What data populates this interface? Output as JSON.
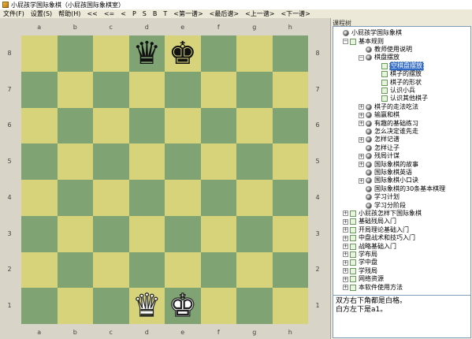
{
  "window": {
    "title": "小屁孩学国际象棋（小屁孩国际象棋室）"
  },
  "menu": [
    "文件(F)",
    "设置(S)",
    "帮助(H)",
    "<<",
    "<=",
    "<",
    "P",
    "S",
    "B",
    "T",
    "<第一谱>",
    "<最后谱>",
    "<上一谱>",
    "<下一谱>"
  ],
  "board": {
    "files": [
      "a",
      "b",
      "c",
      "d",
      "e",
      "f",
      "g",
      "h"
    ],
    "ranks": [
      "8",
      "7",
      "6",
      "5",
      "4",
      "3",
      "2",
      "1"
    ],
    "pieces": [
      {
        "square": "d8",
        "glyph": "♛",
        "color": "black",
        "name": "black-queen"
      },
      {
        "square": "e8",
        "glyph": "♚",
        "color": "black",
        "name": "black-king"
      },
      {
        "square": "d1",
        "glyph": "♛",
        "color": "white",
        "name": "white-queen"
      },
      {
        "square": "e1",
        "glyph": "♚",
        "color": "white",
        "name": "white-king"
      }
    ],
    "colors": {
      "light": "#d7d37a",
      "dark": "#7fa372"
    }
  },
  "tree": {
    "header": "课程树",
    "nodes": [
      {
        "label": "小屁孩学国际象棋",
        "level": 0,
        "icon": "ball",
        "expander": ""
      },
      {
        "label": "基本规则",
        "level": 1,
        "icon": "page",
        "expander": "−"
      },
      {
        "label": "教师使用说明",
        "level": 2,
        "icon": "ball",
        "expander": ""
      },
      {
        "label": "棋盘摆放",
        "level": 2,
        "icon": "ball",
        "expander": "−"
      },
      {
        "label": "空棋盘摆放",
        "level": 3,
        "icon": "page",
        "expander": "",
        "selected": true
      },
      {
        "label": "棋子的摆放",
        "level": 3,
        "icon": "page",
        "expander": ""
      },
      {
        "label": "棋子的形状",
        "level": 3,
        "icon": "page",
        "expander": ""
      },
      {
        "label": "认识小兵",
        "level": 3,
        "icon": "page",
        "expander": ""
      },
      {
        "label": "认识其他棋子",
        "level": 3,
        "icon": "page",
        "expander": ""
      },
      {
        "label": "棋子的走法吃法",
        "level": 2,
        "icon": "ball",
        "expander": "+"
      },
      {
        "label": "输赢和棋",
        "level": 2,
        "icon": "ball",
        "expander": "+"
      },
      {
        "label": "有趣的基础练习",
        "level": 2,
        "icon": "ball",
        "expander": "+"
      },
      {
        "label": "怎么决定谁先走",
        "level": 2,
        "icon": "ball",
        "expander": ""
      },
      {
        "label": "怎样记谱",
        "level": 2,
        "icon": "ball",
        "expander": "+"
      },
      {
        "label": "怎样让子",
        "level": 2,
        "icon": "ball",
        "expander": ""
      },
      {
        "label": "残局计谋",
        "level": 2,
        "icon": "ball",
        "expander": "+"
      },
      {
        "label": "国际象棋的故事",
        "level": 2,
        "icon": "ball",
        "expander": "+"
      },
      {
        "label": "国际象棋英语",
        "level": 2,
        "icon": "ball",
        "expander": ""
      },
      {
        "label": "国际象棋小口诀",
        "level": 2,
        "icon": "ball",
        "expander": "+"
      },
      {
        "label": "国际象棋的30条基本棋理",
        "level": 2,
        "icon": "ball",
        "expander": ""
      },
      {
        "label": "学习计划",
        "level": 2,
        "icon": "ball",
        "expander": ""
      },
      {
        "label": "学习分阶段",
        "level": 2,
        "icon": "ball",
        "expander": ""
      },
      {
        "label": "小屁孩怎样下国际象棋",
        "level": 1,
        "icon": "page",
        "expander": "+"
      },
      {
        "label": "基础残局入门",
        "level": 1,
        "icon": "page",
        "expander": "+"
      },
      {
        "label": "开局理论基础入门",
        "level": 1,
        "icon": "page",
        "expander": "+"
      },
      {
        "label": "中盘战术和技巧入门",
        "level": 1,
        "icon": "page",
        "expander": "+"
      },
      {
        "label": "战略基础入门",
        "level": 1,
        "icon": "page",
        "expander": "+"
      },
      {
        "label": "学布局",
        "level": 1,
        "icon": "page",
        "expander": "+"
      },
      {
        "label": "学中盘",
        "level": 1,
        "icon": "page",
        "expander": "+"
      },
      {
        "label": "学残局",
        "level": 1,
        "icon": "page",
        "expander": "+"
      },
      {
        "label": "网络资源",
        "level": 1,
        "icon": "page",
        "expander": "+"
      },
      {
        "label": "本软件使用方法",
        "level": 1,
        "icon": "page",
        "expander": "+"
      }
    ]
  },
  "notes": [
    "双方右下角都是白格。",
    "白方左下是a1。"
  ]
}
